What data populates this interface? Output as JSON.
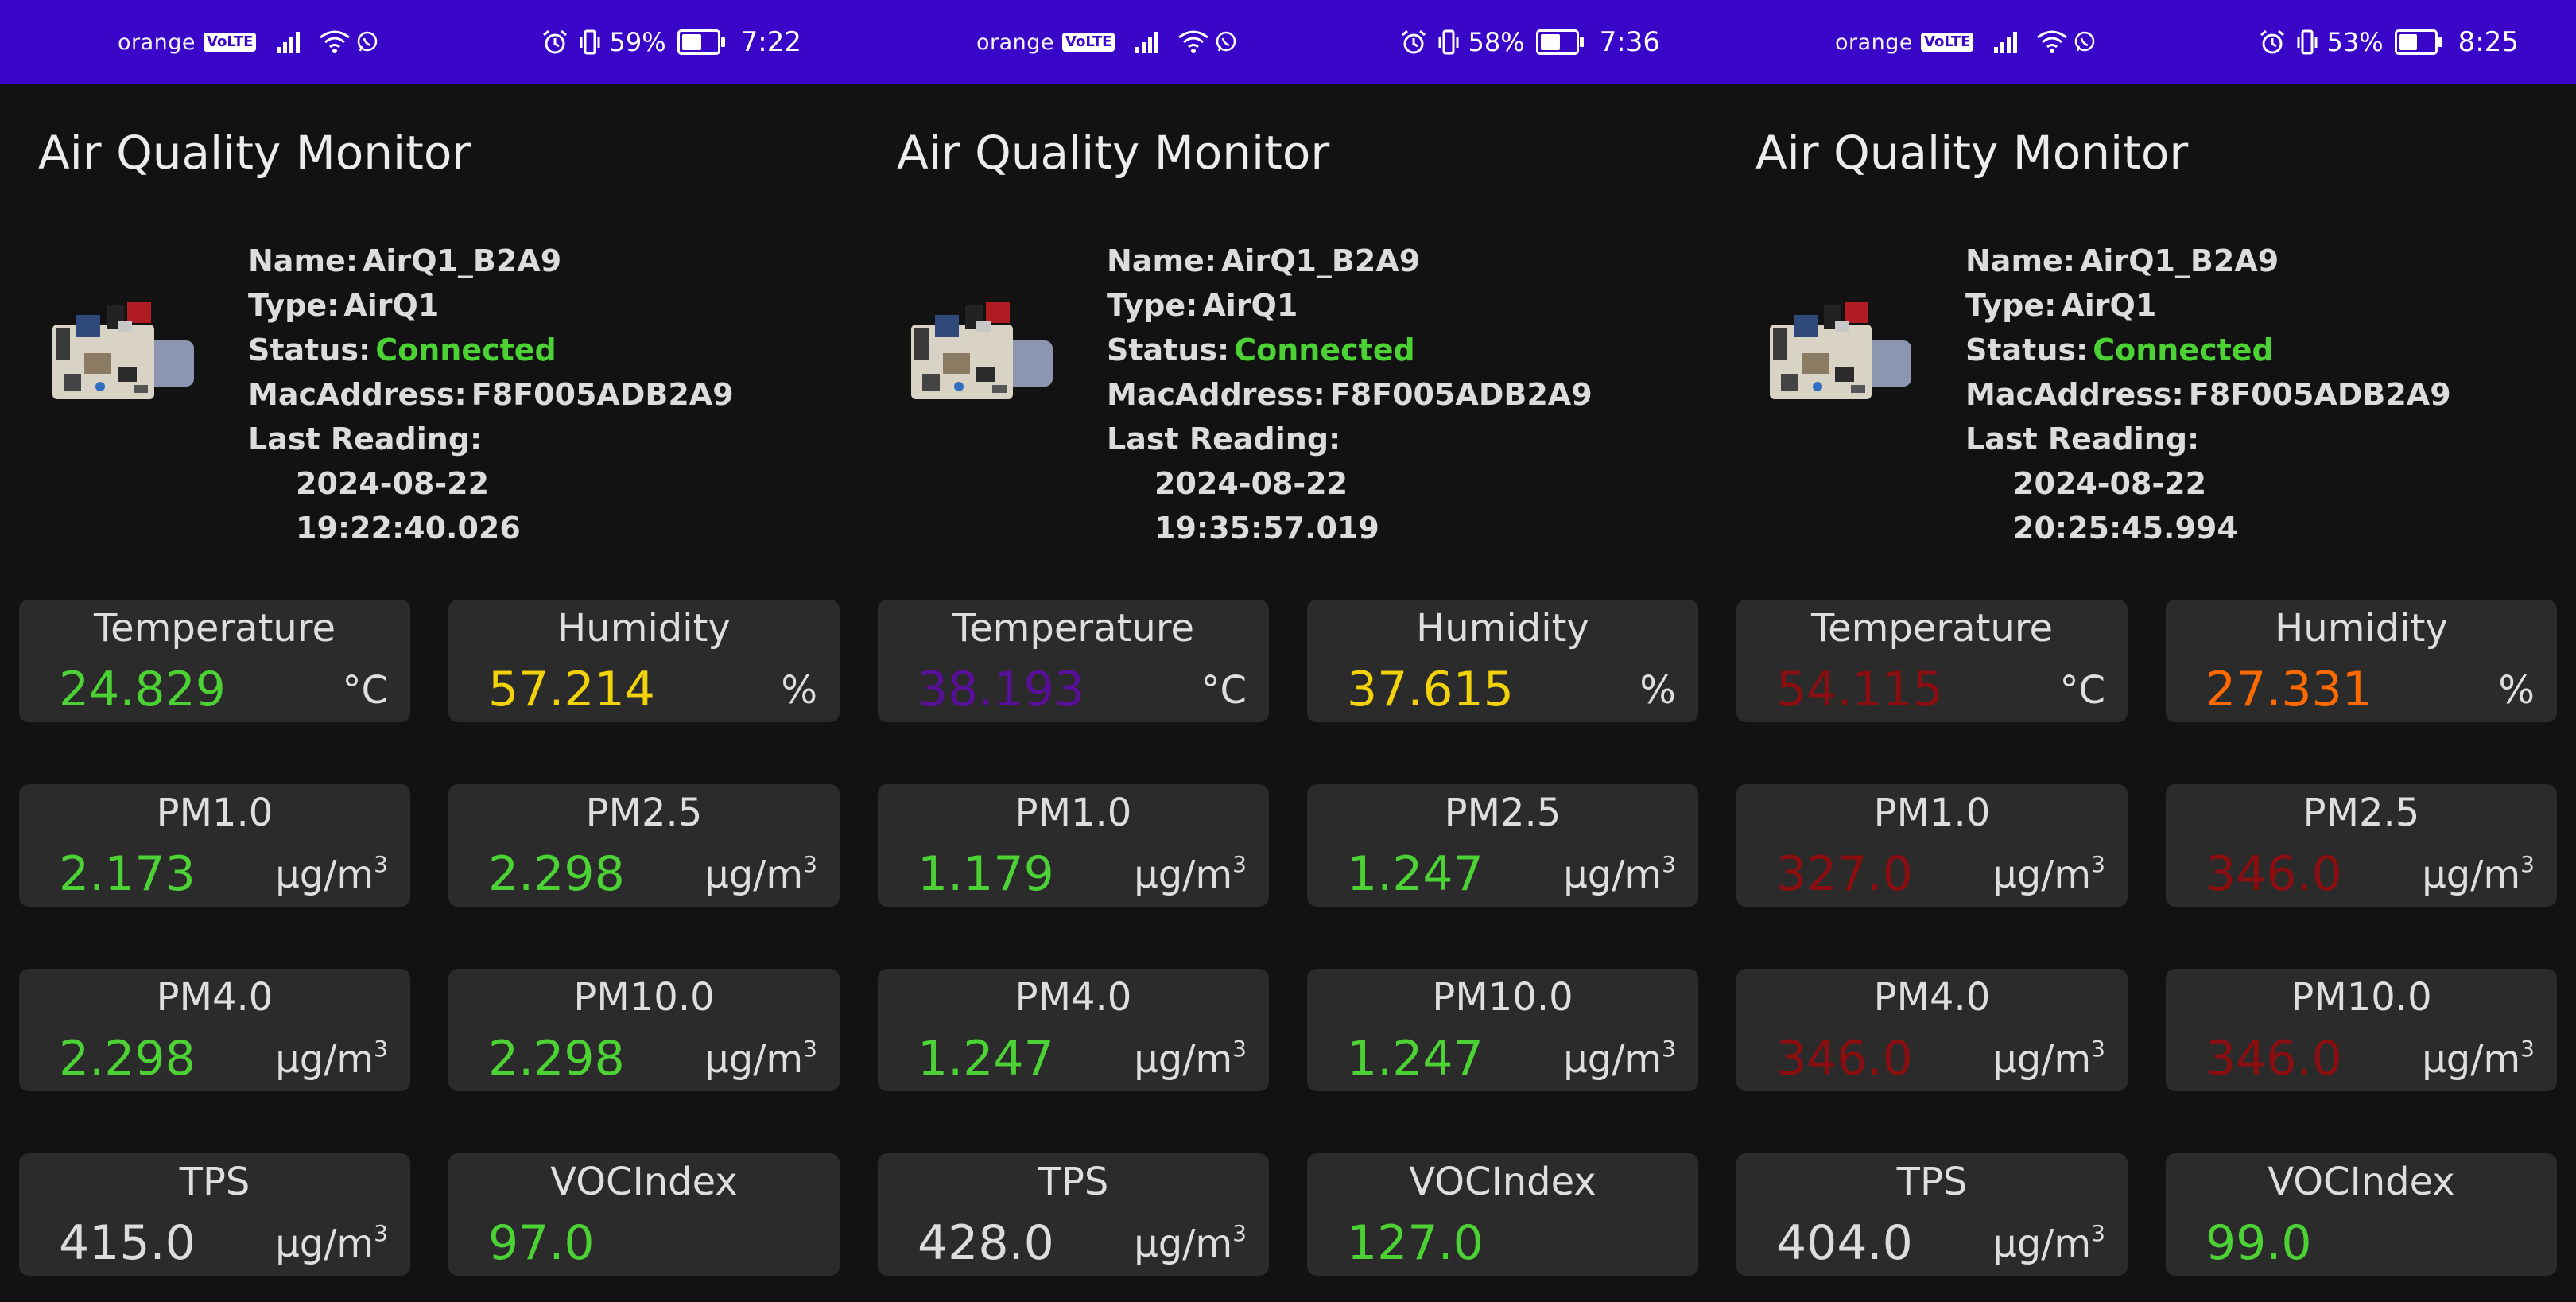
{
  "colors": {
    "statusbar": "#3a07c9",
    "good": "#4cd235",
    "moderate": "#f2d20a",
    "warm": "#ff6a00",
    "bad": "#8a0d10",
    "purple": "#5a0f9a",
    "neutral": "#dcdcdc"
  },
  "panels": [
    {
      "status_bar": {
        "carrier": "orange",
        "volte": "VoLTE",
        "battery": "59%",
        "time": "7:22"
      },
      "title": "Air Quality Monitor",
      "device": {
        "name_label": "Name:",
        "name": "AirQ1_B2A9",
        "type_label": "Type:",
        "type": "AirQ1",
        "status_label": "Status:",
        "status": "Connected",
        "mac_label": "MacAddress:",
        "mac": "F8F005ADB2A9",
        "last_label": "Last Reading:",
        "date": "2024-08-22",
        "time": "19:22:40.026"
      },
      "sensors": [
        {
          "label": "Temperature",
          "value": "24.829",
          "unit": "°C",
          "color": "#4cd235"
        },
        {
          "label": "Humidity",
          "value": "57.214",
          "unit": "%",
          "color": "#f2d20a"
        },
        {
          "label": "PM1.0",
          "value": "2.173",
          "unit": "μg/m",
          "sup": "3",
          "color": "#4cd235"
        },
        {
          "label": "PM2.5",
          "value": "2.298",
          "unit": "μg/m",
          "sup": "3",
          "color": "#4cd235"
        },
        {
          "label": "PM4.0",
          "value": "2.298",
          "unit": "μg/m",
          "sup": "3",
          "color": "#4cd235"
        },
        {
          "label": "PM10.0",
          "value": "2.298",
          "unit": "μg/m",
          "sup": "3",
          "color": "#4cd235"
        },
        {
          "label": "TPS",
          "value": "415.0",
          "unit": "μg/m",
          "sup": "3",
          "color": "#dcdcdc"
        },
        {
          "label": "VOCIndex",
          "value": "97.0",
          "unit": "",
          "sup": "",
          "color": "#4cd235"
        }
      ]
    },
    {
      "status_bar": {
        "carrier": "orange",
        "volte": "VoLTE",
        "battery": "58%",
        "time": "7:36"
      },
      "title": "Air Quality Monitor",
      "device": {
        "name_label": "Name:",
        "name": "AirQ1_B2A9",
        "type_label": "Type:",
        "type": "AirQ1",
        "status_label": "Status:",
        "status": "Connected",
        "mac_label": "MacAddress:",
        "mac": "F8F005ADB2A9",
        "last_label": "Last Reading:",
        "date": "2024-08-22",
        "time": "19:35:57.019"
      },
      "sensors": [
        {
          "label": "Temperature",
          "value": "38.193",
          "unit": "°C",
          "color": "#5a0f9a"
        },
        {
          "label": "Humidity",
          "value": "37.615",
          "unit": "%",
          "color": "#f2d20a"
        },
        {
          "label": "PM1.0",
          "value": "1.179",
          "unit": "μg/m",
          "sup": "3",
          "color": "#4cd235"
        },
        {
          "label": "PM2.5",
          "value": "1.247",
          "unit": "μg/m",
          "sup": "3",
          "color": "#4cd235"
        },
        {
          "label": "PM4.0",
          "value": "1.247",
          "unit": "μg/m",
          "sup": "3",
          "color": "#4cd235"
        },
        {
          "label": "PM10.0",
          "value": "1.247",
          "unit": "μg/m",
          "sup": "3",
          "color": "#4cd235"
        },
        {
          "label": "TPS",
          "value": "428.0",
          "unit": "μg/m",
          "sup": "3",
          "color": "#dcdcdc"
        },
        {
          "label": "VOCIndex",
          "value": "127.0",
          "unit": "",
          "sup": "",
          "color": "#4cd235"
        }
      ]
    },
    {
      "status_bar": {
        "carrier": "orange",
        "volte": "VoLTE",
        "battery": "53%",
        "time": "8:25"
      },
      "title": "Air Quality Monitor",
      "device": {
        "name_label": "Name:",
        "name": "AirQ1_B2A9",
        "type_label": "Type:",
        "type": "AirQ1",
        "status_label": "Status:",
        "status": "Connected",
        "mac_label": "MacAddress:",
        "mac": "F8F005ADB2A9",
        "last_label": "Last Reading:",
        "date": "2024-08-22",
        "time": "20:25:45.994"
      },
      "sensors": [
        {
          "label": "Temperature",
          "value": "54.115",
          "unit": "°C",
          "color": "#8a0d10"
        },
        {
          "label": "Humidity",
          "value": "27.331",
          "unit": "%",
          "color": "#ff6a00"
        },
        {
          "label": "PM1.0",
          "value": "327.0",
          "unit": "μg/m",
          "sup": "3",
          "color": "#8a0d10"
        },
        {
          "label": "PM2.5",
          "value": "346.0",
          "unit": "μg/m",
          "sup": "3",
          "color": "#8a0d10"
        },
        {
          "label": "PM4.0",
          "value": "346.0",
          "unit": "μg/m",
          "sup": "3",
          "color": "#8a0d10"
        },
        {
          "label": "PM10.0",
          "value": "346.0",
          "unit": "μg/m",
          "sup": "3",
          "color": "#8a0d10"
        },
        {
          "label": "TPS",
          "value": "404.0",
          "unit": "μg/m",
          "sup": "3",
          "color": "#dcdcdc"
        },
        {
          "label": "VOCIndex",
          "value": "99.0",
          "unit": "",
          "sup": "",
          "color": "#4cd235"
        }
      ]
    }
  ]
}
